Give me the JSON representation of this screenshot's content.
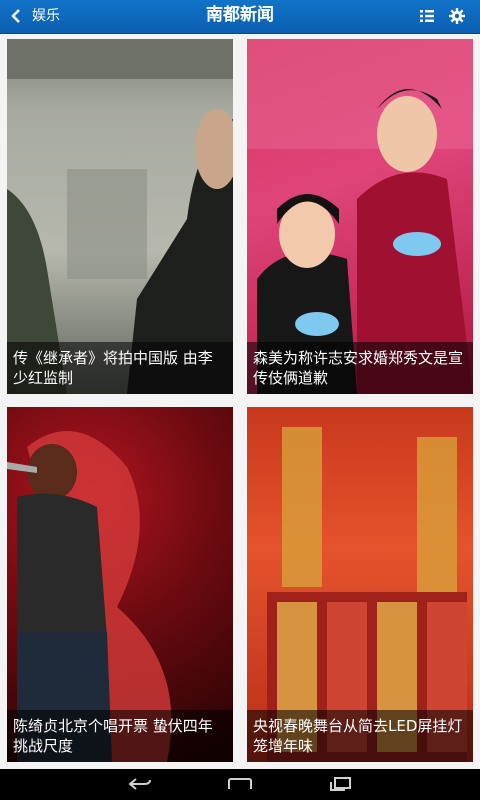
{
  "header": {
    "section_label": "娱乐",
    "title": "南都新闻",
    "icons": [
      "back-arrow-icon",
      "list-icon",
      "gear-icon"
    ]
  },
  "cards": [
    {
      "caption": "传《继承者》将拍中国版 由李少红监制"
    },
    {
      "caption": "森美为称许志安求婚郑秀文是宣传伎俩道歉"
    },
    {
      "caption": "陈绮贞北京个唱开票 蛰伏四年挑战尺度"
    },
    {
      "caption": "央视春晚舞台从简去LED屏挂灯笼增年味"
    }
  ],
  "navbar": {
    "icons": [
      "back-nav-icon",
      "home-nav-icon",
      "recent-apps-icon"
    ]
  },
  "colors": {
    "appbar": "#0b6bc0",
    "background": "#f4f4f4",
    "caption_overlay": "rgba(0,0,0,0.55)"
  }
}
